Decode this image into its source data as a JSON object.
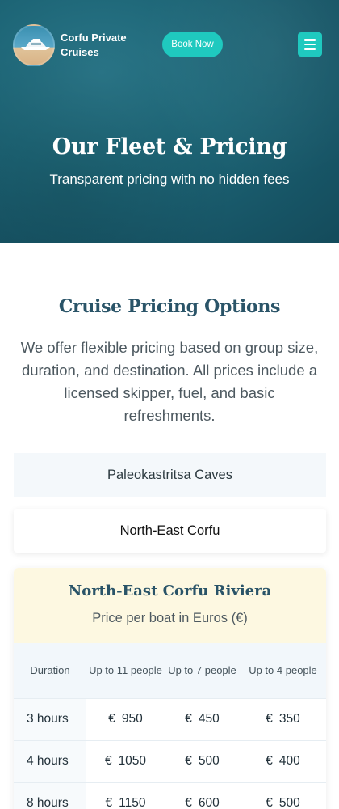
{
  "header": {
    "brand_line1": "Corfu Private",
    "brand_line2": "Cruises",
    "book_label": "Book Now"
  },
  "hero": {
    "title": "Our Fleet & Pricing",
    "subtitle": "Transparent pricing with no hidden fees"
  },
  "pricing": {
    "title": "Cruise Pricing Options",
    "description": "We offer flexible pricing based on group size, duration, and destination. All prices include a licensed skipper, fuel, and basic refreshments.",
    "tabs": [
      {
        "label": "Paleokastritsa Caves",
        "active": false
      },
      {
        "label": "North-East Corfu",
        "active": true
      }
    ],
    "card": {
      "title": "North-East Corfu Riviera",
      "subtitle": "Price per boat in Euros (€)",
      "columns": [
        "Duration",
        "Up to 11 people",
        "Up to 7 people",
        "Up to 4 people"
      ],
      "currency_symbol": "€",
      "rows": [
        {
          "duration": "3 hours",
          "prices": [
            "950",
            "450",
            "350"
          ]
        },
        {
          "duration": "4 hours",
          "prices": [
            "1050",
            "500",
            "400"
          ]
        },
        {
          "duration": "8 hours",
          "prices": [
            "1150",
            "600",
            "500"
          ]
        }
      ]
    }
  },
  "colors": {
    "accent": "#1fc9bf",
    "hero_bg": "#1d6576",
    "heading": "#2a5468",
    "card_header_bg": "#fdf8e1"
  }
}
